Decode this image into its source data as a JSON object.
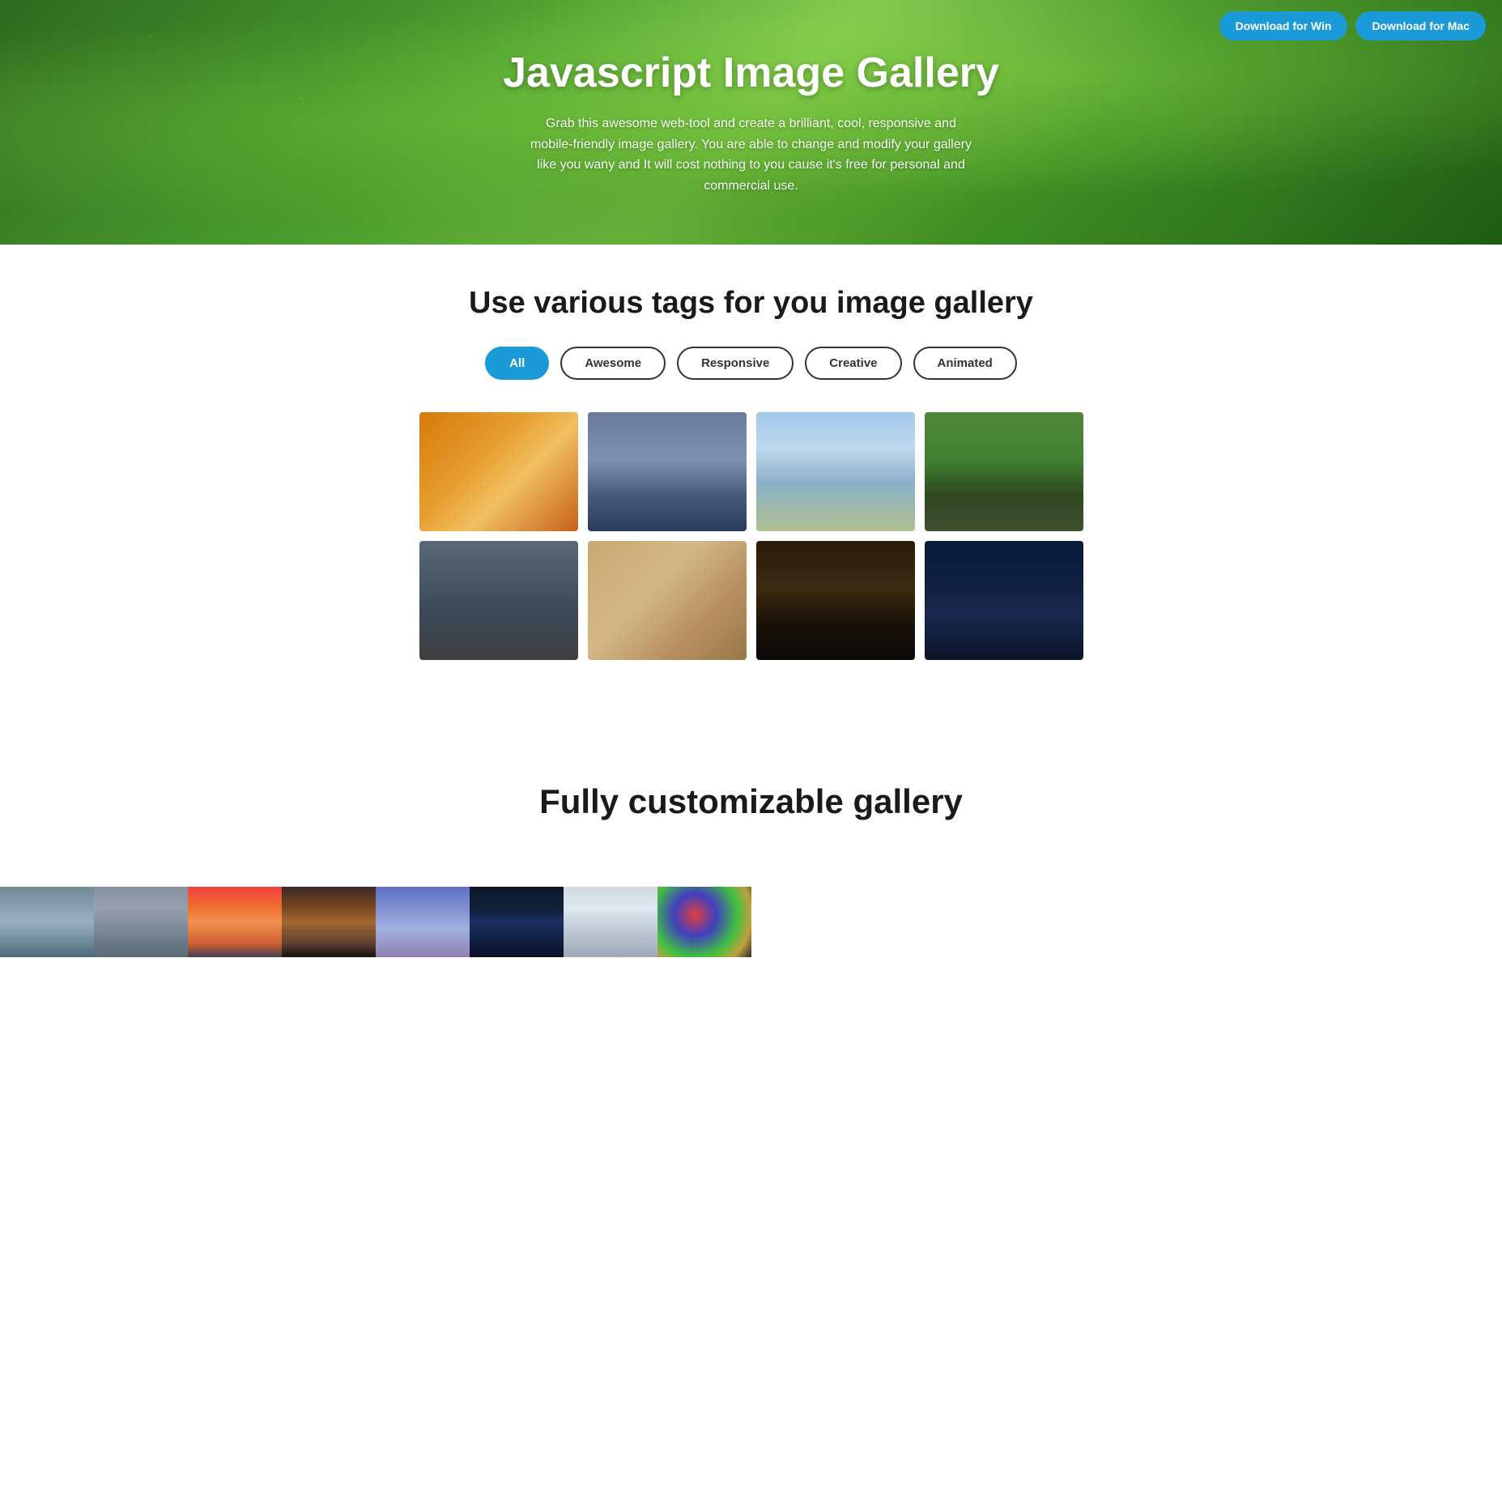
{
  "header": {
    "btn_win_label": "Download for Win",
    "btn_mac_label": "Download for Mac"
  },
  "hero": {
    "title": "Javascript Image Gallery",
    "description": "Grab this awesome web-tool and create a brilliant, cool, responsive and mobile-friendly image gallery. You are able to change and modify your gallery like you wany and It will cost nothing to you cause it's free for personal and commercial use."
  },
  "tags_section": {
    "title": "Use various tags for you image gallery",
    "filters": [
      {
        "id": "all",
        "label": "All",
        "active": true
      },
      {
        "id": "awesome",
        "label": "Awesome",
        "active": false
      },
      {
        "id": "responsive",
        "label": "Responsive",
        "active": false
      },
      {
        "id": "creative",
        "label": "Creative",
        "active": false
      },
      {
        "id": "animated",
        "label": "Animated",
        "active": false
      }
    ]
  },
  "gallery": {
    "images": [
      {
        "id": 1,
        "alt": "Autumn forest",
        "class": "img-autumn"
      },
      {
        "id": 2,
        "alt": "Bridge at dusk",
        "class": "img-bridge"
      },
      {
        "id": 3,
        "alt": "Paris cityscape",
        "class": "img-paris"
      },
      {
        "id": 4,
        "alt": "Deer in forest",
        "class": "img-deer"
      },
      {
        "id": 5,
        "alt": "Mountain cloudscape",
        "class": "img-mountain"
      },
      {
        "id": 6,
        "alt": "Rock formation",
        "class": "img-rock"
      },
      {
        "id": 7,
        "alt": "Open book",
        "class": "img-book"
      },
      {
        "id": 8,
        "alt": "Night sky tent",
        "class": "img-night"
      }
    ]
  },
  "custom_section": {
    "title": "Fully customizable gallery"
  },
  "bottom_gallery": {
    "row1": [
      {
        "id": 1,
        "alt": "Kirkjufell waterfall",
        "class": "img-kirkjufell"
      },
      {
        "id": 2,
        "alt": "White cliffs",
        "class": "img-cliff"
      },
      {
        "id": 3,
        "alt": "Sunset beach",
        "class": "img-sunset"
      },
      {
        "id": 4,
        "alt": "Dusk mountains",
        "class": "img-dusk"
      }
    ],
    "row2": [
      {
        "id": 5,
        "alt": "Purple cliffs",
        "class": "img-cliffs2"
      },
      {
        "id": 6,
        "alt": "Milky way",
        "class": "img-milky"
      },
      {
        "id": 7,
        "alt": "Snowy mountains",
        "class": "img-snowy"
      },
      {
        "id": 8,
        "alt": "Colorful ball",
        "class": "img-ball"
      }
    ]
  }
}
